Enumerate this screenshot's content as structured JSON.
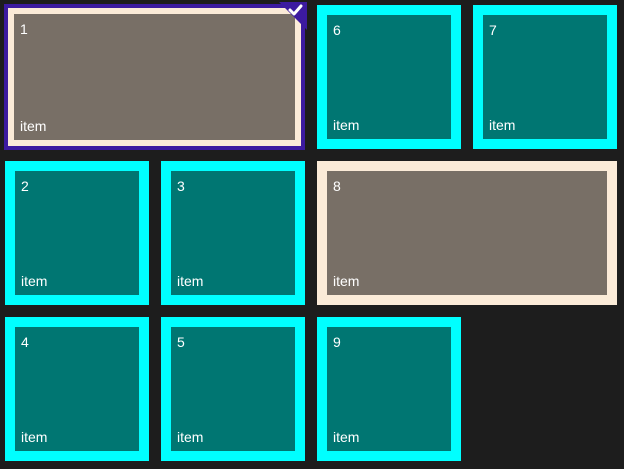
{
  "colors": {
    "background": "#1d1d1d",
    "teal_fill": "#007672",
    "teal_border": "#00ffff",
    "gray_fill": "#786f66",
    "cream_border": "#fbebd8",
    "selection_outer": "#3c1aa0",
    "checkmark": "#ffffff"
  },
  "tiles": [
    {
      "number": "1",
      "label": "item",
      "selected": true,
      "variant": "wide-gray"
    },
    {
      "number": "6",
      "label": "item",
      "selected": false,
      "variant": "teal"
    },
    {
      "number": "7",
      "label": "item",
      "selected": false,
      "variant": "teal"
    },
    {
      "number": "2",
      "label": "item",
      "selected": false,
      "variant": "teal"
    },
    {
      "number": "3",
      "label": "item",
      "selected": false,
      "variant": "teal"
    },
    {
      "number": "8",
      "label": "item",
      "selected": false,
      "variant": "wide-gray"
    },
    {
      "number": "4",
      "label": "item",
      "selected": false,
      "variant": "teal"
    },
    {
      "number": "5",
      "label": "item",
      "selected": false,
      "variant": "teal"
    },
    {
      "number": "9",
      "label": "item",
      "selected": false,
      "variant": "teal"
    }
  ],
  "icons": {
    "selected_check": "checkmark-icon"
  }
}
